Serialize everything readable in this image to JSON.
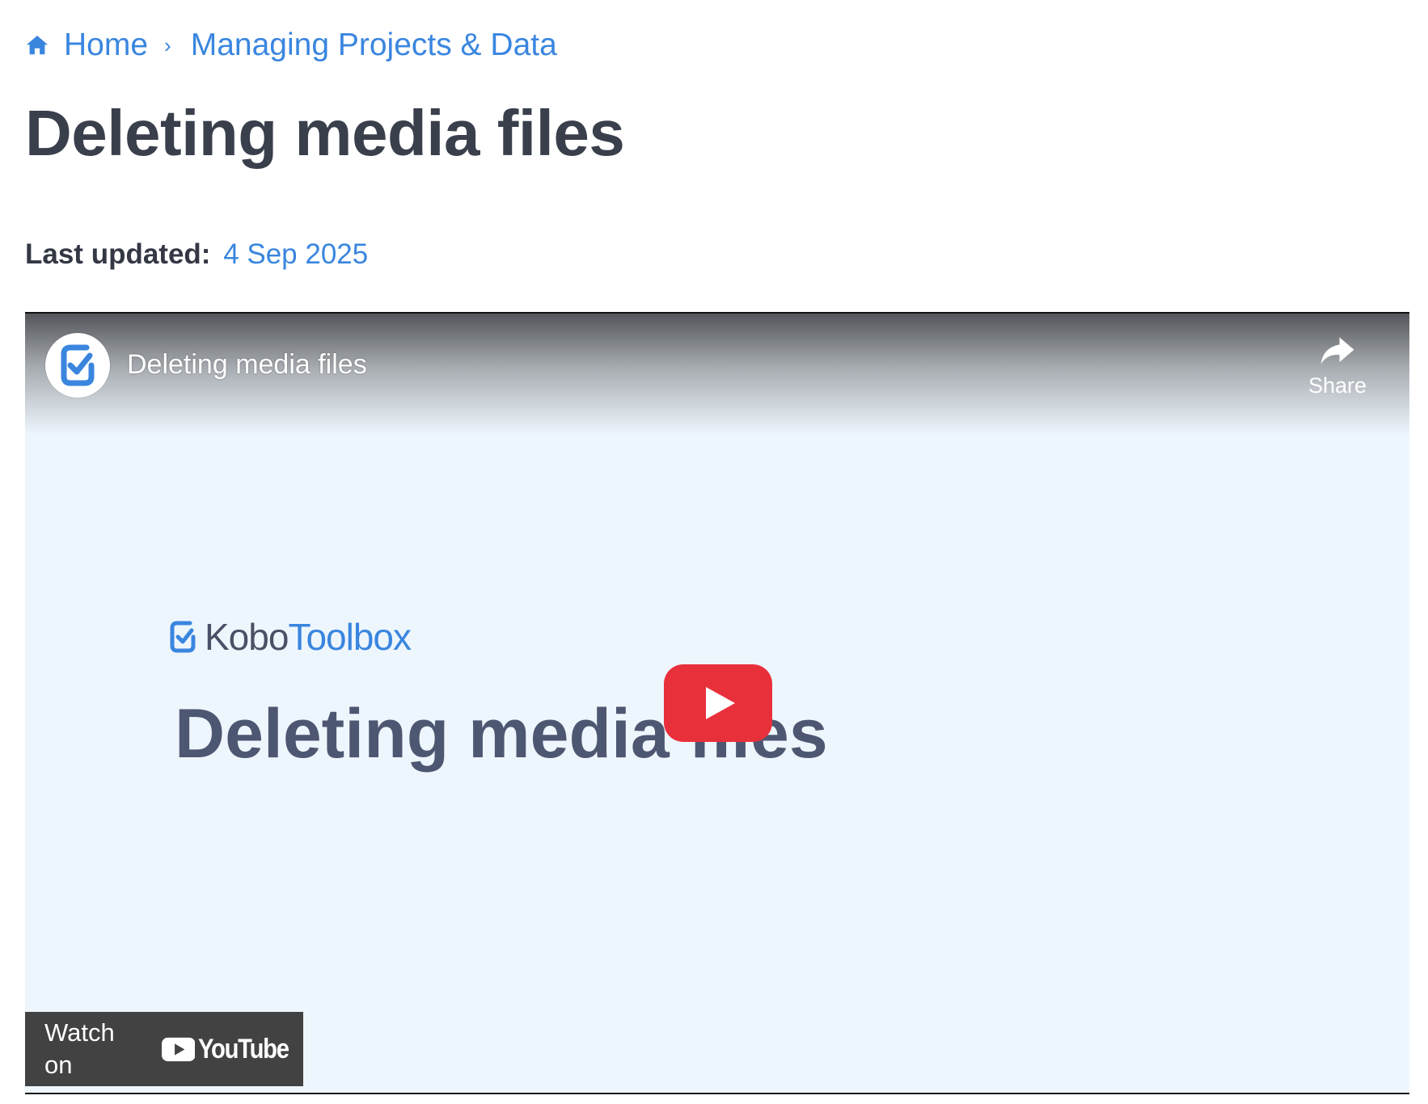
{
  "breadcrumb": {
    "home_icon": "home-icon",
    "home_label": "Home",
    "separator": "›",
    "section_label": "Managing Projects & Data"
  },
  "article": {
    "title": "Deleting media files",
    "last_updated_label": "Last updated:",
    "last_updated_date": "4 Sep 2025"
  },
  "video": {
    "title": "Deleting media files",
    "share_label": "Share",
    "share_icon": "share-arrow-icon",
    "channel_avatar_icon": "kobotoolbox-logo-icon",
    "thumbnail": {
      "brand_kobo": "Kobo",
      "brand_toolbox": "Toolbox",
      "title": "Deleting media files"
    },
    "play_icon": "play-icon",
    "watch_on_label": "Watch on",
    "youtube_word": "YouTube"
  },
  "colors": {
    "link": "#3a86df",
    "title_text": "#3a3f4c",
    "play_button": "#e8303b",
    "watch_on_bg": "#424242",
    "thumbnail_bg": "#eef6fd"
  }
}
